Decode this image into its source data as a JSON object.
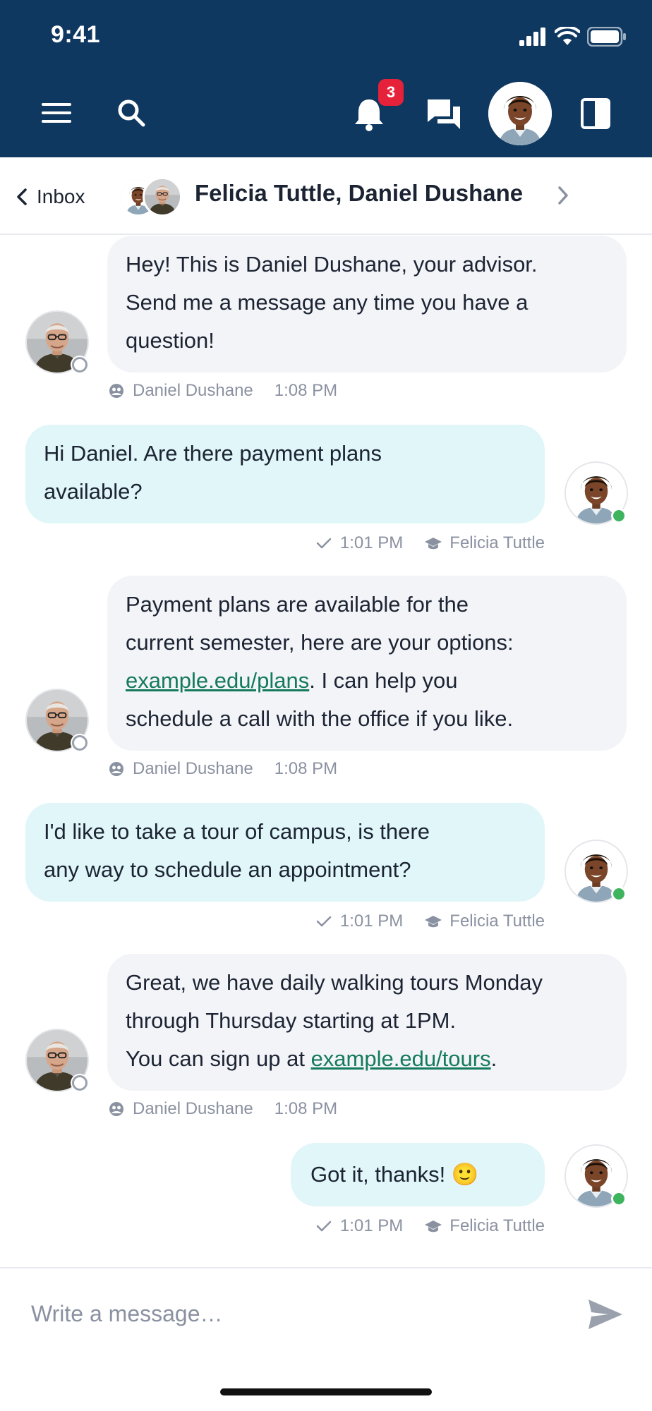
{
  "status_bar": {
    "time": "9:41"
  },
  "top_bar": {
    "notification_count": "3"
  },
  "header": {
    "back_label": "Inbox",
    "title": "Felicia Tuttle, Daniel Dushane"
  },
  "messages": [
    {
      "direction": "in",
      "lines": [
        "Hey! This is Daniel Dushane, your advisor.",
        "Send me a message any time you have a",
        "question!"
      ],
      "sender": "Daniel Dushane",
      "time": "1:08 PM"
    },
    {
      "direction": "out",
      "lines": [
        "Hi Daniel. Are there payment plans",
        "available?"
      ],
      "sender": "Felicia Tuttle",
      "time": "1:01 PM"
    },
    {
      "direction": "in",
      "line1": "Payment plans are available for the",
      "line2": "current semester, here are your options:",
      "link": "example.edu/plans",
      "line3_after_link": ". I can help you",
      "line4": "schedule a call with the office if you like.",
      "sender": "Daniel Dushane",
      "time": "1:08 PM"
    },
    {
      "direction": "out",
      "lines": [
        "I'd like to take a tour of campus, is there",
        "any way to schedule an appointment?"
      ],
      "sender": "Felicia Tuttle",
      "time": "1:01 PM"
    },
    {
      "direction": "in",
      "line1": "Great, we have daily walking tours Monday",
      "line2": "through Thursday starting at 1PM.",
      "line3_before_link": "You can sign up at ",
      "link": "example.edu/tours",
      "line3_after_link": ".",
      "sender": "Daniel Dushane",
      "time": "1:08 PM"
    },
    {
      "direction": "out",
      "text": "Got it, thanks! 🙂",
      "sender": "Felicia Tuttle",
      "time": "1:01 PM"
    }
  ],
  "composer": {
    "placeholder": "Write a message…"
  },
  "colors": {
    "header_bg": "#0e3860",
    "badge": "#e5223a",
    "incoming_bubble": "#f3f4f8",
    "outgoing_bubble": "#e0f6f8",
    "link": "#147a5c",
    "online": "#3fb45f"
  }
}
